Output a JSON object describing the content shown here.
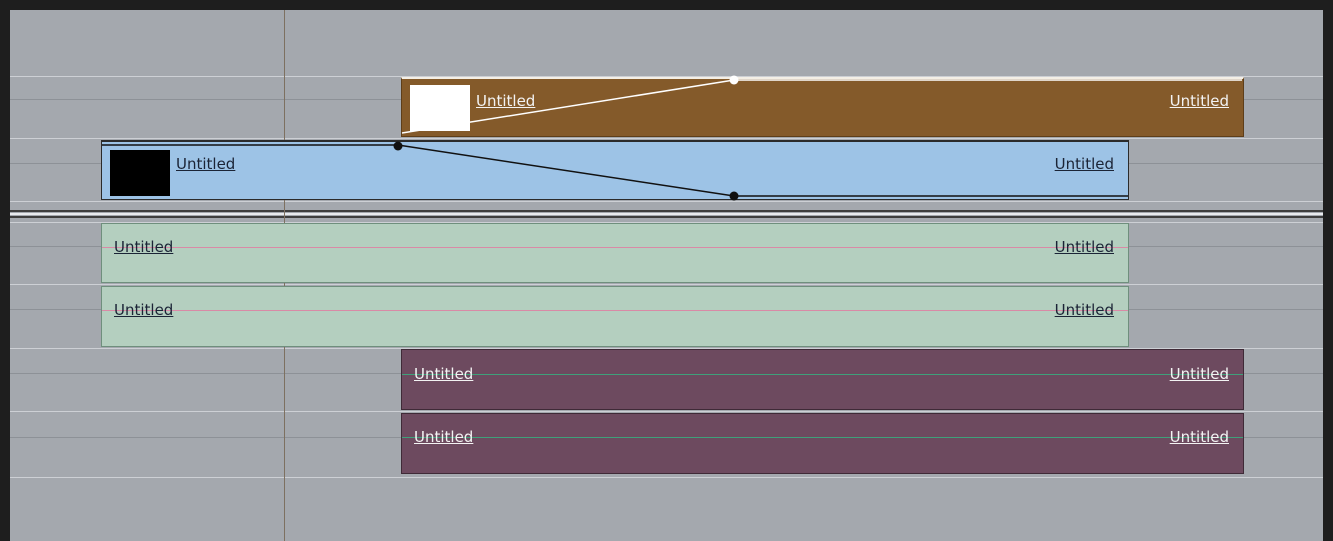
{
  "timeline": {
    "clips": [
      {
        "track": "video-2",
        "start_label": "Untitled",
        "end_label": "Untitled",
        "color": "#845a2a",
        "thumbnail": "white"
      },
      {
        "track": "video-1",
        "start_label": "Untitled",
        "end_label": "Untitled",
        "color": "#9dc3e6",
        "thumbnail": "black"
      },
      {
        "track": "audio-1",
        "start_label": "Untitled",
        "end_label": "Untitled",
        "color": "#b4cfbf"
      },
      {
        "track": "audio-2",
        "start_label": "Untitled",
        "end_label": "Untitled",
        "color": "#b4cfbf"
      },
      {
        "track": "audio-3",
        "start_label": "Untitled",
        "end_label": "Untitled",
        "color": "#6d4a5f"
      },
      {
        "track": "audio-4",
        "start_label": "Untitled",
        "end_label": "Untitled",
        "color": "#6d4a5f"
      }
    ],
    "colors": {
      "background": "#a4a8ae",
      "green_level_line": "#d98aa6",
      "purple_level_line": "#3fa07a"
    }
  }
}
